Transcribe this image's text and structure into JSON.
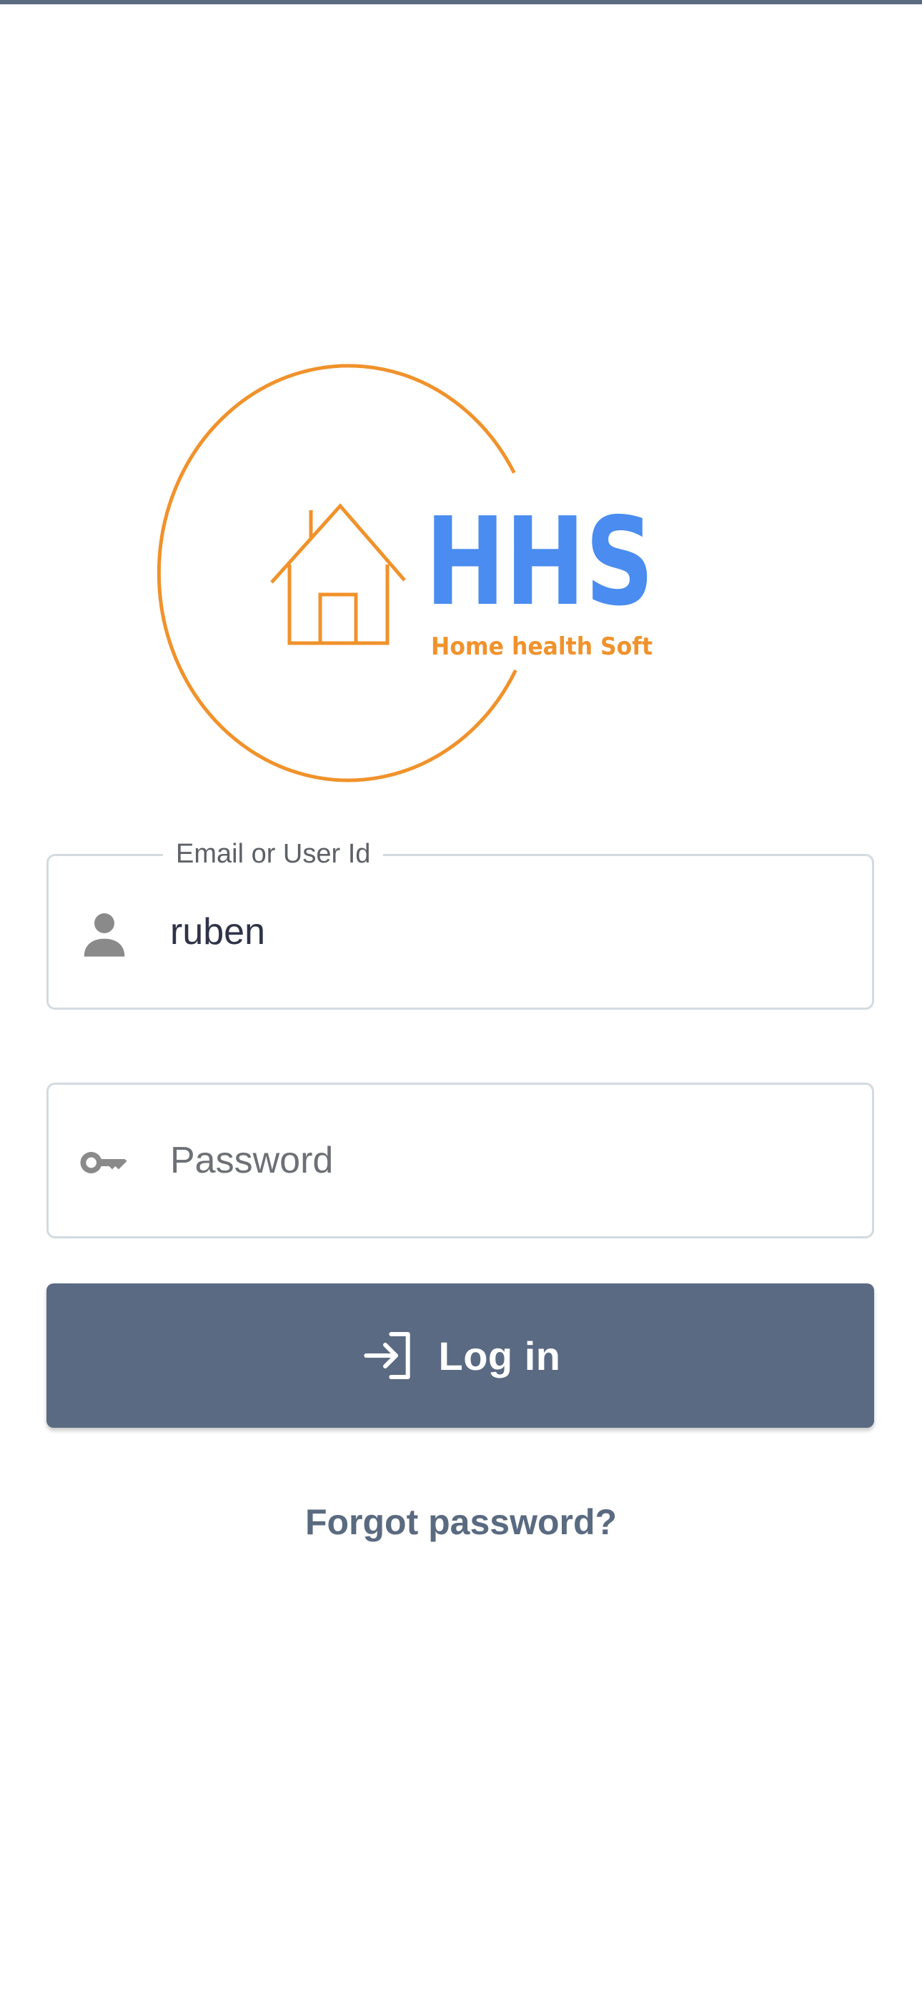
{
  "logo": {
    "title": "HHS",
    "subtitle": "Home health Soft",
    "colors": {
      "orange": "#f0922b",
      "blue": "#4a8cf0"
    }
  },
  "login_form": {
    "email_field": {
      "label": "Email or User Id",
      "value": "ruben",
      "icon": "person-icon"
    },
    "password_field": {
      "placeholder": "Password",
      "value": "",
      "icon": "key-icon"
    },
    "login_button": {
      "label": "Log in",
      "icon": "login-arrow-icon",
      "color": "#5a6a82"
    },
    "forgot_password": {
      "label": "Forgot password?"
    }
  },
  "theme": {
    "top_bar_color": "#5a6a80",
    "border_color": "#d3dbdf",
    "icon_color": "#8a8a8a"
  }
}
